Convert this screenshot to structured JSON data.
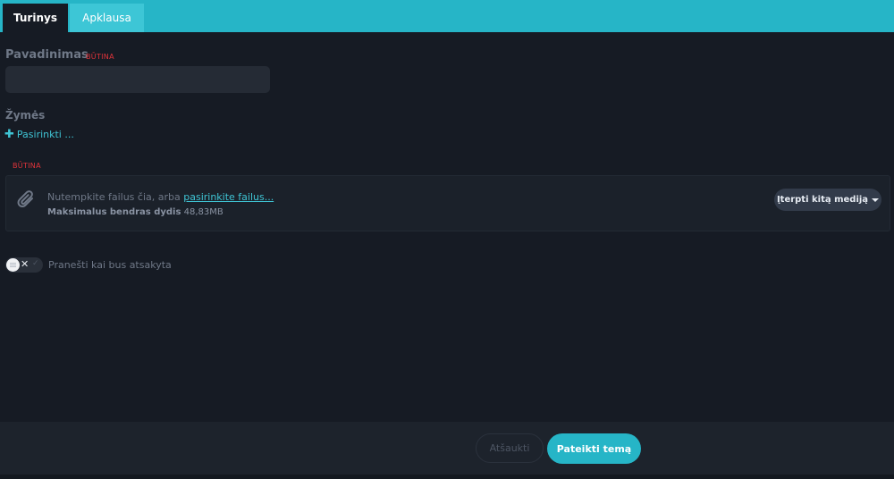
{
  "tabs": {
    "content": "Turinys",
    "poll": "Apklausa"
  },
  "title_field": {
    "label": "Pavadinimas",
    "required": "BŪTINA",
    "value": ""
  },
  "tags": {
    "label": "Žymės",
    "add": "Pasirinkti ..."
  },
  "attachments": {
    "required": "BŪTINA",
    "drop_text": "Nutempkite failus čia, arba ",
    "browse_link": "pasirinkite failus...",
    "max_size_label": "Maksimalus bendras dydis",
    "max_size_value": "48,83MB",
    "insert_media": "Įterpti kitą mediją"
  },
  "notify": {
    "label": "Pranešti kai bus atsakyta",
    "enabled": false
  },
  "footer": {
    "cancel": "Atšaukti",
    "submit": "Pateikti temą"
  },
  "colors": {
    "accent": "#26b5c7",
    "background": "#161b24",
    "required": "#e0343a"
  }
}
